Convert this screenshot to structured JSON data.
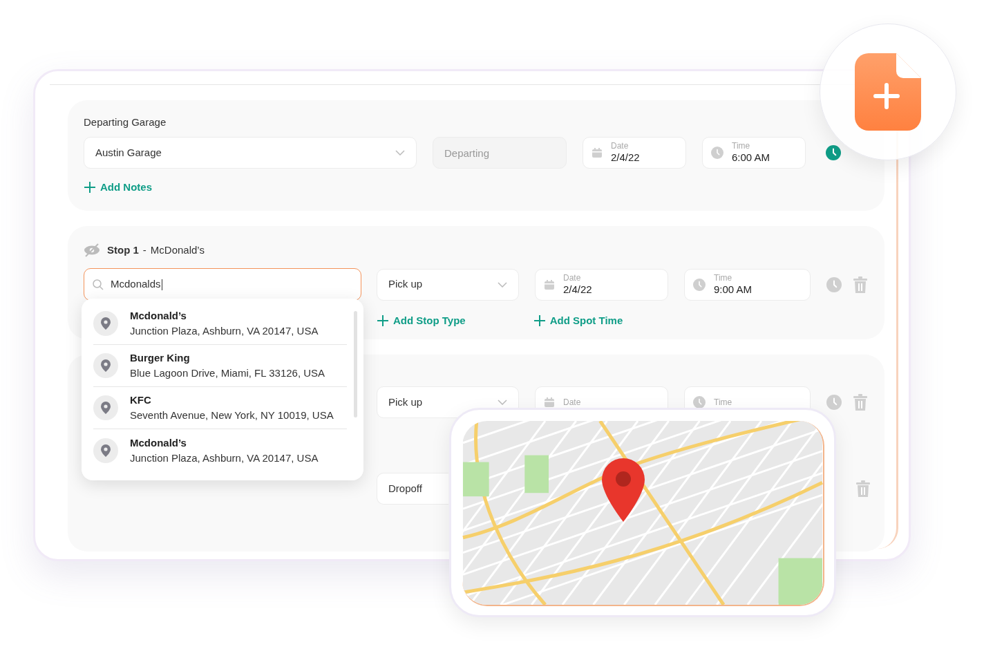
{
  "departing": {
    "label": "Departing Garage",
    "garage": {
      "value": "Austin Garage"
    },
    "departing": {
      "placeholder": "Departing"
    },
    "date": {
      "label": "Date",
      "value": "2/4/22"
    },
    "time": {
      "label": "Time",
      "value": "6:00 AM",
      "set": true
    },
    "add_link": "Add Notes"
  },
  "stop": {
    "title": "Stop 1",
    "separator": "-",
    "name": "McDonald’s",
    "search": {
      "value": "Mcdonalds",
      "focused": true
    },
    "type": {
      "value": "Pick up"
    },
    "date": {
      "label": "Date",
      "value": "2/4/22"
    },
    "time": {
      "label": "Time",
      "value": "9:00 AM",
      "set": false
    },
    "links": [
      "Add Stop Type",
      "Add Spot Time"
    ]
  },
  "suggestions": [
    {
      "name": "Mcdonald’s",
      "address": "Junction Plaza, Ashburn, VA 20147, USA"
    },
    {
      "name": "Burger King",
      "address": "Blue Lagoon Drive, Miami, FL 33126, USA"
    },
    {
      "name": "KFC",
      "address": "Seventh Avenue, New York, NY 10019, USA"
    },
    {
      "name": "Mcdonald’s",
      "address": "Junction Plaza, Ashburn, VA 20147, USA"
    }
  ],
  "next_stop": {
    "rows": [
      {
        "kind": "pickup",
        "type": "Pick up",
        "date_label": "Date",
        "time_label": "Time",
        "time_set": false
      },
      {
        "kind": "dropoff",
        "type": "Dropoff"
      }
    ]
  }
}
